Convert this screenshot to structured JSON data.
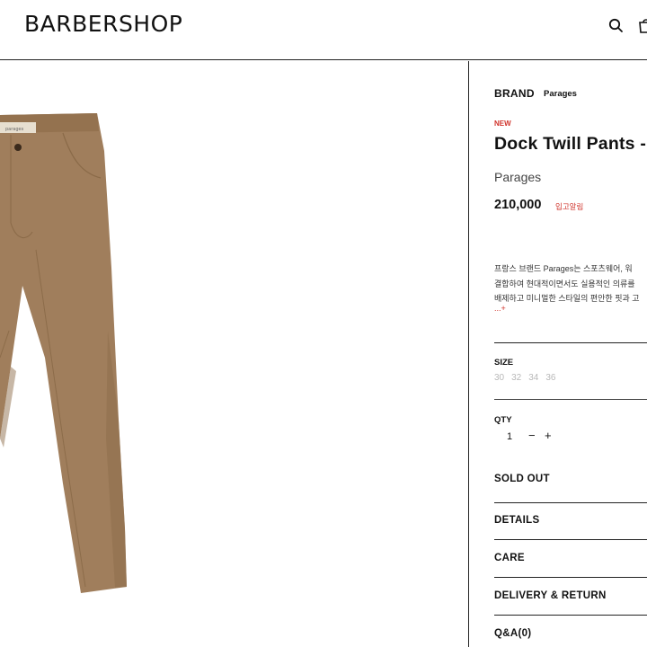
{
  "header": {
    "logo": "BARBERSHOP",
    "search_icon": "search-icon",
    "bag_icon": "shopping-bag-icon"
  },
  "product": {
    "image_alt": "khaki twill pants",
    "image_color": "#a07e5c",
    "brand_label": "BRAND",
    "brand_value": "Parages",
    "badge": "NEW",
    "title": "Dock Twill Pants -",
    "subbrand": "Parages",
    "price": "210,000",
    "restock": "입고알림",
    "description": [
      "프랑스 브랜드 Parages는 스포츠웨어, 워",
      "결합하여 현대적이면서도 실용적인 의류를",
      "배제하고 미니멀한 스타일의 편안한 핏과 고"
    ],
    "more": "...+",
    "accent_color": "#d0342c"
  },
  "options": {
    "size_label": "SIZE",
    "sizes": [
      "30",
      "32",
      "34",
      "36"
    ],
    "qty_label": "QTY",
    "qty_value": "1",
    "minus": "−",
    "plus": "+"
  },
  "actions": {
    "soldout": "SOLD OUT"
  },
  "accordion": [
    {
      "label": "DETAILS"
    },
    {
      "label": "CARE"
    },
    {
      "label": "DELIVERY & RETURN"
    },
    {
      "label": "Q&A(0)"
    }
  ]
}
